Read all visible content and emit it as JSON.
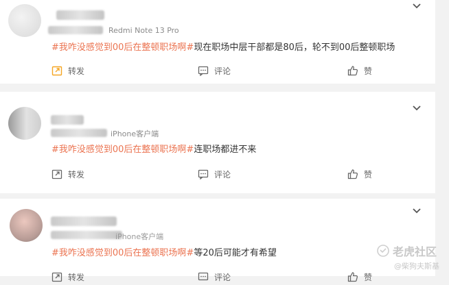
{
  "posts": [
    {
      "device": "Redmi Note 13 Pro",
      "hashtag": "#我咋没感觉到00后在整顿职场啊#",
      "text": "现在职场中层干部都是80后，轮不到00后整顿职场",
      "actions": {
        "forward": "转发",
        "comment": "评论",
        "like": "赞"
      }
    },
    {
      "device": "iPhone客户端",
      "hashtag": "#我咋没感觉到00后在整顿职场啊#",
      "text": "连职场都进不来",
      "actions": {
        "forward": "转发",
        "comment": "评论",
        "like": "赞"
      }
    },
    {
      "device": "iPhone客户端",
      "hashtag": "#我咋没感觉到00后在整顿职场啊#",
      "text": "等20后可能才有希望",
      "actions": {
        "forward": "转发",
        "comment": "评论",
        "like": "赞"
      }
    }
  ],
  "watermark": {
    "brand": "老虎社区",
    "user": "@柴狗夫斯基"
  },
  "colors": {
    "hashtag": "#eb7350",
    "forward_highlight": "#f5a623"
  }
}
